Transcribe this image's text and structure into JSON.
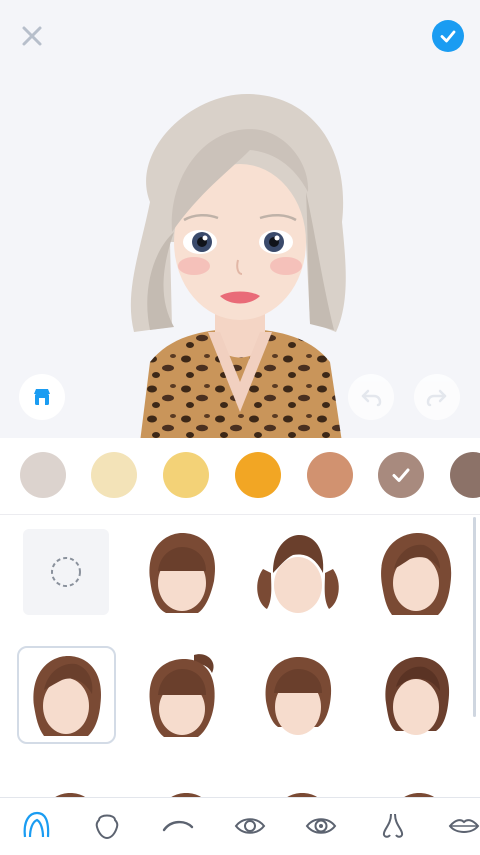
{
  "toolbar": {
    "close_icon": "close-icon",
    "confirm_icon": "check-circle-icon",
    "accent": "#1a9cf2"
  },
  "preview_controls": {
    "store_icon": "store-icon",
    "undo_icon": "undo-icon",
    "redo_icon": "redo-icon"
  },
  "hair_colors": [
    "#dcd3ce",
    "#f3e3b8",
    "#f3d277",
    "#f2a624",
    "#d19270",
    "#a88a7e",
    "#8c7268"
  ],
  "selected_color_index": 5,
  "hair_styles": [
    "none",
    "short-bob-bangs",
    "pigtails",
    "side-part-long",
    "side-part-wavy",
    "ponytail-bangs",
    "bob-bangs",
    "sleek-bob",
    "style-9",
    "style-10",
    "style-11",
    "style-12"
  ],
  "selected_style_index": 4,
  "tabs": [
    {
      "icon": "hair-icon",
      "active": true
    },
    {
      "icon": "face-shape-icon",
      "active": false
    },
    {
      "icon": "eyebrow-icon",
      "active": false
    },
    {
      "icon": "eye-icon",
      "active": false
    },
    {
      "icon": "eye-detail-icon",
      "active": false
    },
    {
      "icon": "nose-icon",
      "active": false
    },
    {
      "icon": "lips-icon",
      "active": false
    }
  ],
  "active_tab_color": "#1a9cf2",
  "inactive_tab_color": "#5c6370"
}
